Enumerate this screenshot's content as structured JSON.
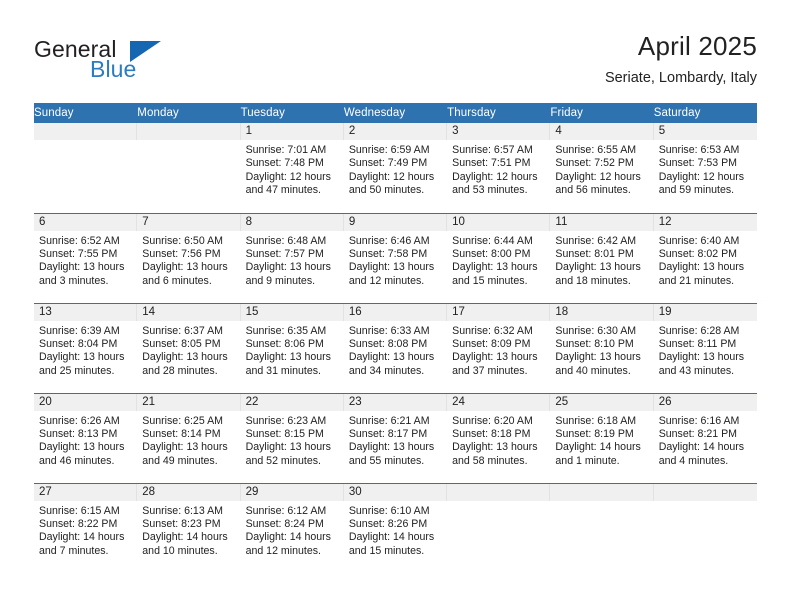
{
  "brand": {
    "name_top": "General",
    "name_bottom": "Blue",
    "triangle_icon": "blue-triangle-logo",
    "color_dark": "#231f20",
    "color_blue": "#2b7cc2"
  },
  "header": {
    "title": "April 2025",
    "subtitle": "Seriate, Lombardy, Italy"
  },
  "theme": {
    "header_blue": "#2e72b0",
    "row_rule_blue": "#2e72b0",
    "daynum_band_gray": "#f0f0f0",
    "text": "#222222"
  },
  "weekday_headers": [
    "Sunday",
    "Monday",
    "Tuesday",
    "Wednesday",
    "Thursday",
    "Friday",
    "Saturday"
  ],
  "weeks": [
    [
      {
        "day": "",
        "lines": []
      },
      {
        "day": "",
        "lines": []
      },
      {
        "day": "1",
        "lines": [
          "Sunrise: 7:01 AM",
          "Sunset: 7:48 PM",
          "Daylight: 12 hours",
          "and 47 minutes."
        ]
      },
      {
        "day": "2",
        "lines": [
          "Sunrise: 6:59 AM",
          "Sunset: 7:49 PM",
          "Daylight: 12 hours",
          "and 50 minutes."
        ]
      },
      {
        "day": "3",
        "lines": [
          "Sunrise: 6:57 AM",
          "Sunset: 7:51 PM",
          "Daylight: 12 hours",
          "and 53 minutes."
        ]
      },
      {
        "day": "4",
        "lines": [
          "Sunrise: 6:55 AM",
          "Sunset: 7:52 PM",
          "Daylight: 12 hours",
          "and 56 minutes."
        ]
      },
      {
        "day": "5",
        "lines": [
          "Sunrise: 6:53 AM",
          "Sunset: 7:53 PM",
          "Daylight: 12 hours",
          "and 59 minutes."
        ]
      }
    ],
    [
      {
        "day": "6",
        "lines": [
          "Sunrise: 6:52 AM",
          "Sunset: 7:55 PM",
          "Daylight: 13 hours",
          "and 3 minutes."
        ]
      },
      {
        "day": "7",
        "lines": [
          "Sunrise: 6:50 AM",
          "Sunset: 7:56 PM",
          "Daylight: 13 hours",
          "and 6 minutes."
        ]
      },
      {
        "day": "8",
        "lines": [
          "Sunrise: 6:48 AM",
          "Sunset: 7:57 PM",
          "Daylight: 13 hours",
          "and 9 minutes."
        ]
      },
      {
        "day": "9",
        "lines": [
          "Sunrise: 6:46 AM",
          "Sunset: 7:58 PM",
          "Daylight: 13 hours",
          "and 12 minutes."
        ]
      },
      {
        "day": "10",
        "lines": [
          "Sunrise: 6:44 AM",
          "Sunset: 8:00 PM",
          "Daylight: 13 hours",
          "and 15 minutes."
        ]
      },
      {
        "day": "11",
        "lines": [
          "Sunrise: 6:42 AM",
          "Sunset: 8:01 PM",
          "Daylight: 13 hours",
          "and 18 minutes."
        ]
      },
      {
        "day": "12",
        "lines": [
          "Sunrise: 6:40 AM",
          "Sunset: 8:02 PM",
          "Daylight: 13 hours",
          "and 21 minutes."
        ]
      }
    ],
    [
      {
        "day": "13",
        "lines": [
          "Sunrise: 6:39 AM",
          "Sunset: 8:04 PM",
          "Daylight: 13 hours",
          "and 25 minutes."
        ]
      },
      {
        "day": "14",
        "lines": [
          "Sunrise: 6:37 AM",
          "Sunset: 8:05 PM",
          "Daylight: 13 hours",
          "and 28 minutes."
        ]
      },
      {
        "day": "15",
        "lines": [
          "Sunrise: 6:35 AM",
          "Sunset: 8:06 PM",
          "Daylight: 13 hours",
          "and 31 minutes."
        ]
      },
      {
        "day": "16",
        "lines": [
          "Sunrise: 6:33 AM",
          "Sunset: 8:08 PM",
          "Daylight: 13 hours",
          "and 34 minutes."
        ]
      },
      {
        "day": "17",
        "lines": [
          "Sunrise: 6:32 AM",
          "Sunset: 8:09 PM",
          "Daylight: 13 hours",
          "and 37 minutes."
        ]
      },
      {
        "day": "18",
        "lines": [
          "Sunrise: 6:30 AM",
          "Sunset: 8:10 PM",
          "Daylight: 13 hours",
          "and 40 minutes."
        ]
      },
      {
        "day": "19",
        "lines": [
          "Sunrise: 6:28 AM",
          "Sunset: 8:11 PM",
          "Daylight: 13 hours",
          "and 43 minutes."
        ]
      }
    ],
    [
      {
        "day": "20",
        "lines": [
          "Sunrise: 6:26 AM",
          "Sunset: 8:13 PM",
          "Daylight: 13 hours",
          "and 46 minutes."
        ]
      },
      {
        "day": "21",
        "lines": [
          "Sunrise: 6:25 AM",
          "Sunset: 8:14 PM",
          "Daylight: 13 hours",
          "and 49 minutes."
        ]
      },
      {
        "day": "22",
        "lines": [
          "Sunrise: 6:23 AM",
          "Sunset: 8:15 PM",
          "Daylight: 13 hours",
          "and 52 minutes."
        ]
      },
      {
        "day": "23",
        "lines": [
          "Sunrise: 6:21 AM",
          "Sunset: 8:17 PM",
          "Daylight: 13 hours",
          "and 55 minutes."
        ]
      },
      {
        "day": "24",
        "lines": [
          "Sunrise: 6:20 AM",
          "Sunset: 8:18 PM",
          "Daylight: 13 hours",
          "and 58 minutes."
        ]
      },
      {
        "day": "25",
        "lines": [
          "Sunrise: 6:18 AM",
          "Sunset: 8:19 PM",
          "Daylight: 14 hours",
          "and 1 minute."
        ]
      },
      {
        "day": "26",
        "lines": [
          "Sunrise: 6:16 AM",
          "Sunset: 8:21 PM",
          "Daylight: 14 hours",
          "and 4 minutes."
        ]
      }
    ],
    [
      {
        "day": "27",
        "lines": [
          "Sunrise: 6:15 AM",
          "Sunset: 8:22 PM",
          "Daylight: 14 hours",
          "and 7 minutes."
        ]
      },
      {
        "day": "28",
        "lines": [
          "Sunrise: 6:13 AM",
          "Sunset: 8:23 PM",
          "Daylight: 14 hours",
          "and 10 minutes."
        ]
      },
      {
        "day": "29",
        "lines": [
          "Sunrise: 6:12 AM",
          "Sunset: 8:24 PM",
          "Daylight: 14 hours",
          "and 12 minutes."
        ]
      },
      {
        "day": "30",
        "lines": [
          "Sunrise: 6:10 AM",
          "Sunset: 8:26 PM",
          "Daylight: 14 hours",
          "and 15 minutes."
        ]
      },
      {
        "day": "",
        "lines": []
      },
      {
        "day": "",
        "lines": []
      },
      {
        "day": "",
        "lines": []
      }
    ]
  ]
}
